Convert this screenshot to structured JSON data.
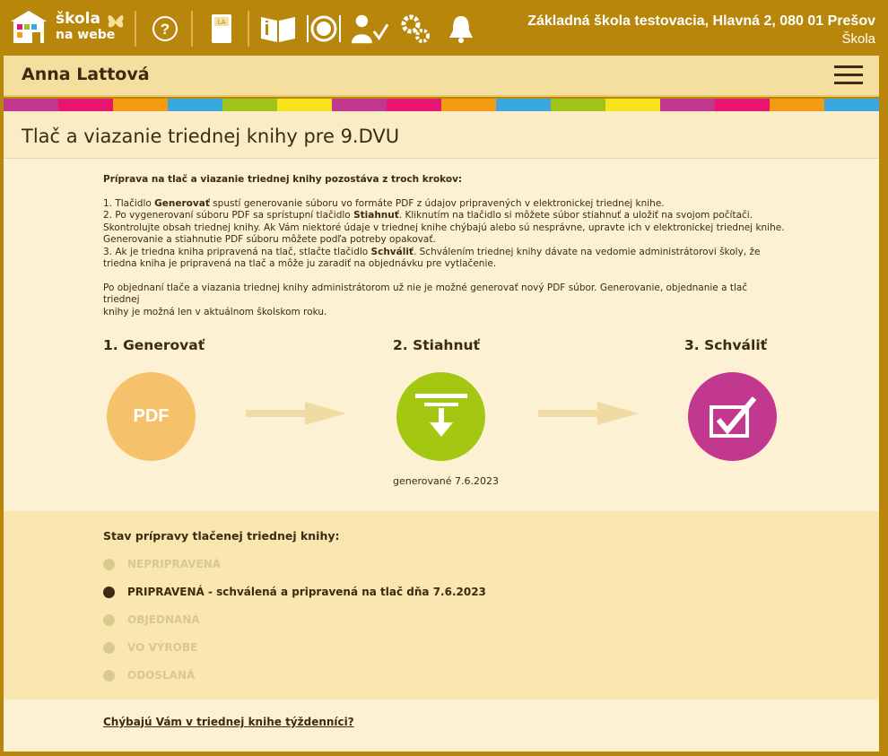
{
  "header": {
    "logo": {
      "line1": "škola",
      "line2": "na webe"
    },
    "school_name": "Základná škola testovacia, Hlavná 2, 080 01 Prešov",
    "school_role": "Škola",
    "icons": [
      "help-icon",
      "class-book-icon",
      "reading-icon",
      "dining-icon",
      "attendance-icon",
      "settings-icon",
      "notifications-icon"
    ]
  },
  "user": {
    "name": "Anna Lattová"
  },
  "colors": {
    "stripes": [
      "#c2388f",
      "#e8156e",
      "#f39c12",
      "#3aa8df",
      "#9ec41c",
      "#f7e21b",
      "#c2388f",
      "#e8156e",
      "#f39c12",
      "#3aa8df",
      "#9ec41c",
      "#f7e21b",
      "#c2388f",
      "#e8156e",
      "#f39c12",
      "#3aa8df"
    ],
    "step1": "#f5c26b",
    "step2": "#a4c812",
    "step3": "#c2388f"
  },
  "page": {
    "title": "Tlač a viazanie triednej knihy pre 9.DVU",
    "intro_heading": "Príprava na tlač a viazanie triednej knihy pozostáva z troch krokov:",
    "step1_a": "1. Tlačidlo ",
    "step1_b": "Generovať",
    "step1_c": " spustí generovanie súboru vo formáte PDF z údajov pripravených v elektronickej triednej knihe.",
    "step2_a": "2. Po vygenerovaní súboru PDF sa sprístupní tlačidlo ",
    "step2_b": "Stiahnuť",
    "step2_c": ". Kliknutím na tlačidlo si môžete súbor stiahnuť a uložiť na svojom počítači.",
    "step2_d": "Skontrolujte obsah triednej knihy. Ak Vám niektoré údaje v triednej knihe chýbajú alebo sú nesprávne, upravte ich v elektronickej triednej knihe.",
    "step2_e": "Generovanie a stiahnutie PDF súboru môžete podľa potreby opakovať.",
    "step3_a": "3. Ak je triedna kniha pripravená na tlač, stlačte tlačidlo ",
    "step3_b": "Schváliť",
    "step3_c": ". Schválením triednej knihy dávate na vedomie administrátorovi školy, že",
    "step3_d": "triedna kniha je pripravená na tlač a môže ju zaradiť na objednávku pre vytlačenie.",
    "note_1": "Po objednaní tlače a viazania triednej knihy administrátorom už nie je možné generovať nový PDF súbor. Generovanie, objednanie a tlač triednej",
    "note_2": "knihy je možná len v aktuálnom školskom roku."
  },
  "steps": [
    {
      "title": "1. Generovať",
      "label": "PDF"
    },
    {
      "title": "2. Stiahnuť",
      "caption": "generované 7.6.2023"
    },
    {
      "title": "3. Schváliť"
    }
  ],
  "status": {
    "title": "Stav prípravy tlačenej triednej knihy:",
    "items": [
      {
        "label": "NEPRIPRAVENÁ",
        "active": false
      },
      {
        "label": "PRIPRAVENÁ - schválená a pripravená na tlač dňa 7.6.2023",
        "active": true
      },
      {
        "label": "OBJEDNANÁ",
        "active": false
      },
      {
        "label": "VO VÝROBE",
        "active": false
      },
      {
        "label": "ODOSLANÁ",
        "active": false
      }
    ]
  },
  "footer_link": "Chýbajú Vám v triednej knihe týždenníci?"
}
